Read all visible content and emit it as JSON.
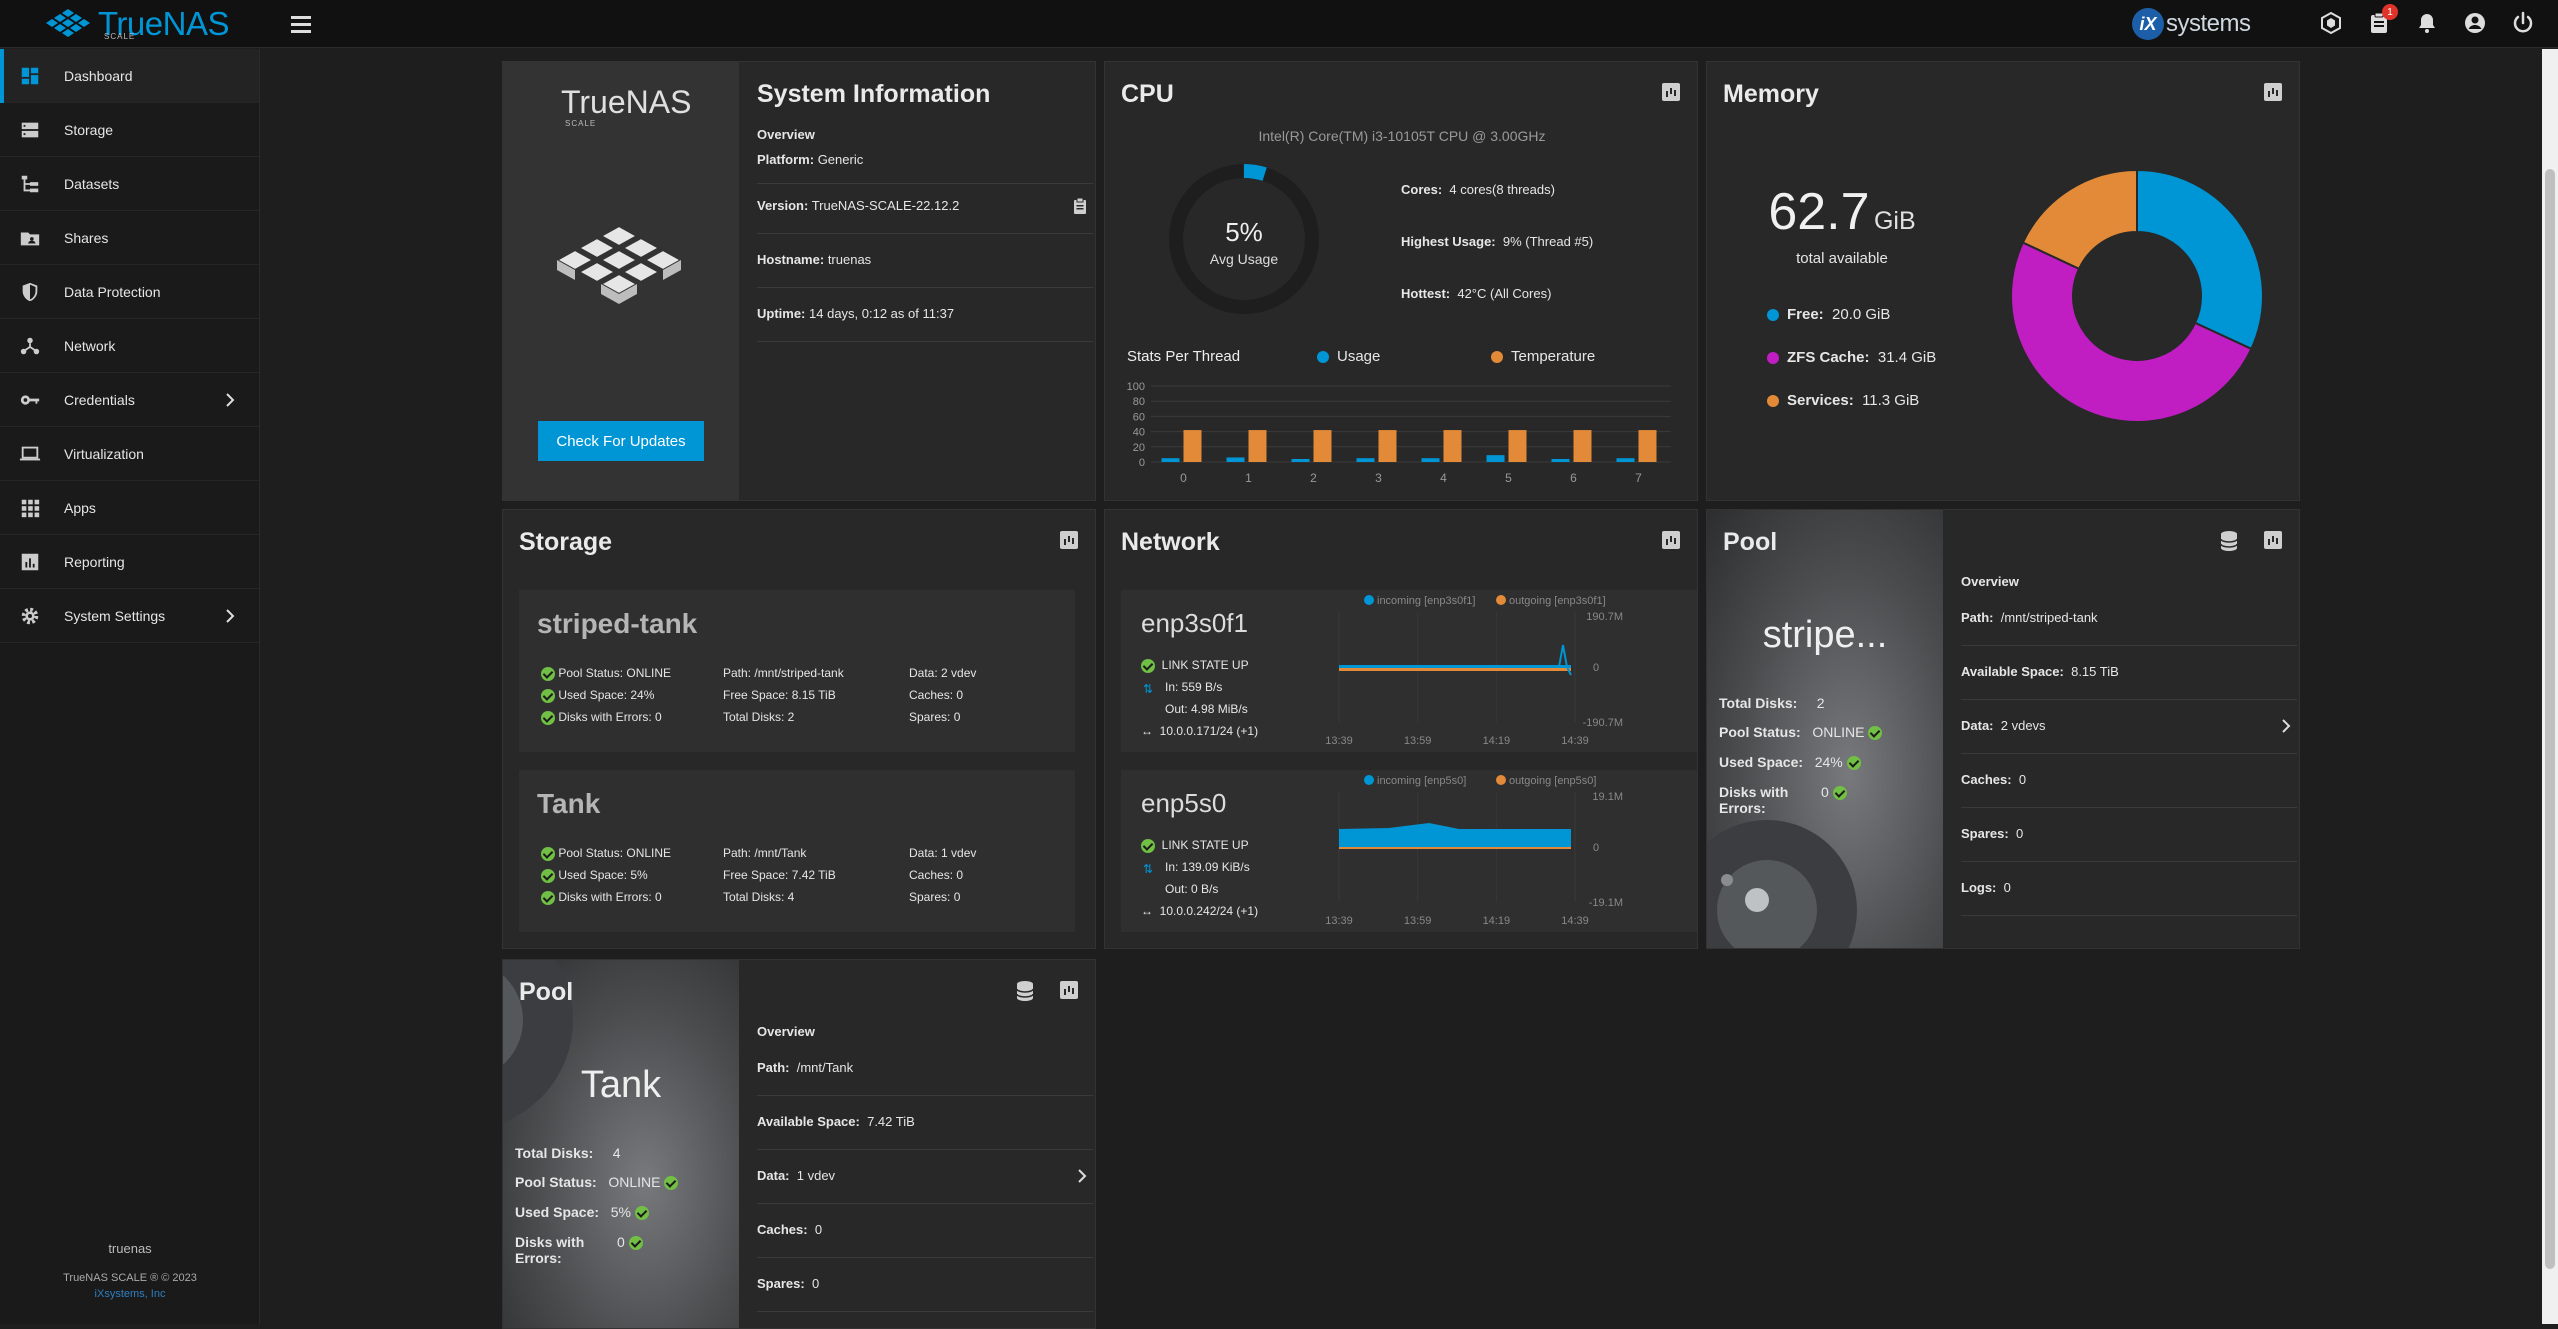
{
  "app": {
    "brand": "TrueNAS",
    "brand_sub": "SCALE",
    "vendor": "systems",
    "vendor_badge": "iX",
    "notifications_count": "1"
  },
  "sidebar": {
    "items": [
      {
        "label": "Dashboard",
        "icon": "dashboard-icon",
        "active": true
      },
      {
        "label": "Storage",
        "icon": "storage-icon"
      },
      {
        "label": "Datasets",
        "icon": "datasets-icon"
      },
      {
        "label": "Shares",
        "icon": "shares-icon"
      },
      {
        "label": "Data Protection",
        "icon": "shield-icon"
      },
      {
        "label": "Network",
        "icon": "network-icon"
      },
      {
        "label": "Credentials",
        "icon": "key-icon",
        "expandable": true
      },
      {
        "label": "Virtualization",
        "icon": "laptop-icon"
      },
      {
        "label": "Apps",
        "icon": "apps-grid-icon"
      },
      {
        "label": "Reporting",
        "icon": "reporting-icon"
      },
      {
        "label": "System Settings",
        "icon": "gear-icon",
        "expandable": true
      }
    ],
    "footer_host": "truenas",
    "footer_copy": "TrueNAS SCALE ® © 2023",
    "footer_link": "iXsystems, Inc"
  },
  "sysinfo": {
    "title": "System Information",
    "logo": "TrueNAS",
    "logo_sub": "SCALE",
    "overview": "Overview",
    "platform_label": "Platform:",
    "platform": "Generic",
    "version_label": "Version:",
    "version": "TrueNAS-SCALE-22.12.2",
    "hostname_label": "Hostname:",
    "hostname": "truenas",
    "uptime_label": "Uptime:",
    "uptime": "14 days, 0:12 as of 11:37",
    "update_button": "Check For Updates"
  },
  "cpu": {
    "title": "CPU",
    "model": "Intel(R) Core(TM) i3-10105T CPU @ 3.00GHz",
    "avg_value": "5%",
    "avg_label": "Avg Usage",
    "cores_label": "Cores:",
    "cores": "4 cores(8 threads)",
    "highest_label": "Highest Usage:",
    "highest": "9%  (Thread #5)",
    "hottest_label": "Hottest:",
    "hottest": "42°C  (All Cores)",
    "stats_title": "Stats Per Thread",
    "legend_usage": "Usage",
    "legend_temp": "Temperature",
    "colors": {
      "usage": "#0095d5",
      "temp": "#e28a37"
    }
  },
  "chart_data": {
    "type": "bar",
    "categories": [
      "0",
      "1",
      "2",
      "3",
      "4",
      "5",
      "6",
      "7"
    ],
    "series": [
      {
        "name": "Usage",
        "values": [
          5,
          6,
          4,
          5,
          5,
          9,
          4,
          5
        ]
      },
      {
        "name": "Temperature",
        "values": [
          42,
          42,
          42,
          42,
          42,
          42,
          42,
          42
        ]
      }
    ],
    "yticks": [
      "100",
      "80",
      "60",
      "40",
      "20",
      "0"
    ],
    "ylim": [
      0,
      100
    ]
  },
  "memory": {
    "title": "Memory",
    "total": "62.7",
    "unit": "GiB",
    "total_label": "total available",
    "free_label": "Free:",
    "free": "20.0 GiB",
    "zfs_label": "ZFS Cache:",
    "zfs": "31.4 GiB",
    "services_label": "Services:",
    "services": "11.3 GiB",
    "colors": {
      "free": "#0095d5",
      "zfs": "#c01ec2",
      "services": "#e28a37"
    },
    "values": [
      20.0,
      31.4,
      11.3
    ]
  },
  "storage": {
    "title": "Storage",
    "pools": [
      {
        "name": "striped-tank",
        "status": "Pool Status:  ONLINE",
        "used": "Used Space:  24%",
        "errors": "Disks with Errors:  0",
        "path": "Path:  /mnt/striped-tank",
        "free": "Free Space:  8.15 TiB",
        "disks": "Total Disks:  2",
        "data": "Data:  2 vdev",
        "caches": "Caches:  0",
        "spares": "Spares:  0"
      },
      {
        "name": "Tank",
        "status": "Pool Status:  ONLINE",
        "used": "Used Space:  5%",
        "errors": "Disks with Errors:  0",
        "path": "Path:  /mnt/Tank",
        "free": "Free Space:  7.42 TiB",
        "disks": "Total Disks:  4",
        "data": "Data:  1 vdev",
        "caches": "Caches:  0",
        "spares": "Spares:  0"
      }
    ]
  },
  "network": {
    "title": "Network",
    "ifaces": [
      {
        "name": "enp3s0f1",
        "state": "LINK STATE UP",
        "in": "In:   559 B/s",
        "out": "Out:   4.98 MiB/s",
        "ip": "10.0.0.171/24 (+1)",
        "legend_in": "incoming [enp3s0f1]",
        "legend_out": "outgoing [enp3s0f1]",
        "ymax": "190.7M",
        "yzero": "0",
        "ymin": "-190.7M",
        "xticks": [
          "13:39",
          "13:59",
          "14:19",
          "14:39"
        ]
      },
      {
        "name": "enp5s0",
        "state": "LINK STATE UP",
        "in": "In:   139.09 KiB/s",
        "out": "Out:   0 B/s",
        "ip": "10.0.0.242/24 (+1)",
        "legend_in": "incoming [enp5s0]",
        "legend_out": "outgoing [enp5s0]",
        "ymax": "19.1M",
        "yzero": "0",
        "ymin": "-19.1M",
        "xticks": [
          "13:39",
          "13:59",
          "14:19",
          "14:39"
        ]
      }
    ]
  },
  "pool_striped": {
    "title": "Pool",
    "hero": "stripe...",
    "total_disks_label": "Total Disks:",
    "total_disks": "2",
    "status_label": "Pool Status:",
    "status": "ONLINE",
    "used_label": "Used Space:",
    "used": "24%",
    "errors_label": "Disks with Errors:",
    "errors": "0",
    "overview": "Overview",
    "path_label": "Path:",
    "path": "/mnt/striped-tank",
    "avail_label": "Available Space:",
    "avail": "8.15 TiB",
    "data_label": "Data:",
    "data": "2 vdevs",
    "caches_label": "Caches:",
    "caches": "0",
    "spares_label": "Spares:",
    "spares": "0",
    "logs_label": "Logs:",
    "logs": "0"
  },
  "pool_tank": {
    "title": "Pool",
    "hero": "Tank",
    "total_disks_label": "Total Disks:",
    "total_disks": "4",
    "status_label": "Pool Status:",
    "status": "ONLINE",
    "used_label": "Used Space:",
    "used": "5%",
    "errors_label": "Disks with Errors:",
    "errors": "0",
    "overview": "Overview",
    "path_label": "Path:",
    "path": "/mnt/Tank",
    "avail_label": "Available Space:",
    "avail": "7.42 TiB",
    "data_label": "Data:",
    "data": "1 vdev",
    "caches_label": "Caches:",
    "caches": "0",
    "spares_label": "Spares:",
    "spares": "0"
  }
}
